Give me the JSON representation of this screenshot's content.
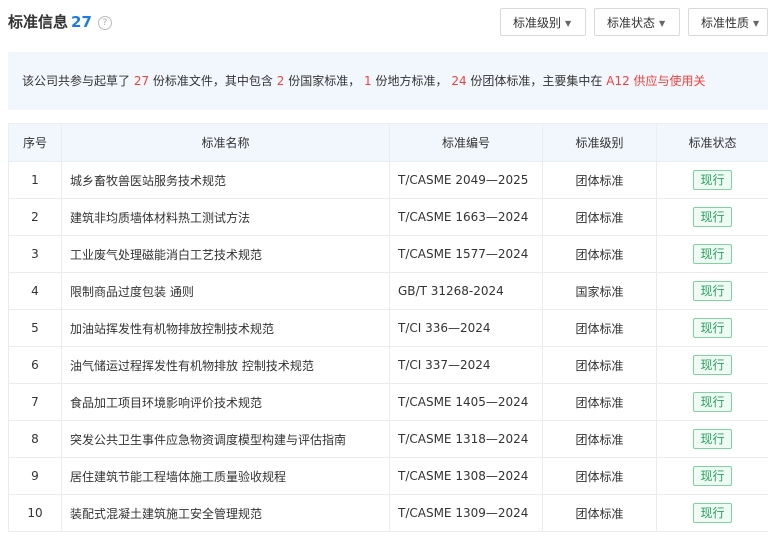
{
  "header": {
    "title": "标准信息",
    "count": "27",
    "help_icon": "?"
  },
  "filters": [
    {
      "label": "标准级别"
    },
    {
      "label": "标准状态"
    },
    {
      "label": "标准性质"
    }
  ],
  "summary": {
    "p1": "该公司共参与起草了 ",
    "n1": "27",
    "p2": " 份标准文件，其中包含 ",
    "n2": "2",
    "p3": " 份国家标准，  ",
    "n3": "1",
    "p4": " 份地方标准，  ",
    "n4": "24",
    "p5": " 份团体标准，主要集中在 ",
    "n5": "A12 供应与使用关",
    "accent_color": "#f5413d"
  },
  "table": {
    "columns": [
      "序号",
      "标准名称",
      "标准编号",
      "标准级别",
      "标准状态"
    ],
    "rows": [
      {
        "no": "1",
        "name": "城乡畜牧兽医站服务技术规范",
        "code": "T/CASME 2049—2025",
        "level": "团体标准",
        "status": "现行"
      },
      {
        "no": "2",
        "name": "建筑非均质墙体材料热工测试方法",
        "code": "T/CASME 1663—2024",
        "level": "团体标准",
        "status": "现行"
      },
      {
        "no": "3",
        "name": "工业废气处理磁能消白工艺技术规范",
        "code": "T/CASME 1577—2024",
        "level": "团体标准",
        "status": "现行"
      },
      {
        "no": "4",
        "name": "限制商品过度包装 通则",
        "code": "GB/T 31268-2024",
        "level": "国家标准",
        "status": "现行"
      },
      {
        "no": "5",
        "name": "加油站挥发性有机物排放控制技术规范",
        "code": "T/CI 336—2024",
        "level": "团体标准",
        "status": "现行"
      },
      {
        "no": "6",
        "name": "油气储运过程挥发性有机物排放 控制技术规范",
        "code": "T/CI 337—2024",
        "level": "团体标准",
        "status": "现行"
      },
      {
        "no": "7",
        "name": "食品加工项目环境影响评价技术规范",
        "code": "T/CASME 1405—2024",
        "level": "团体标准",
        "status": "现行"
      },
      {
        "no": "8",
        "name": "突发公共卫生事件应急物资调度模型构建与评估指南",
        "code": "T/CASME 1318—2024",
        "level": "团体标准",
        "status": "现行"
      },
      {
        "no": "9",
        "name": "居住建筑节能工程墙体施工质量验收规程",
        "code": "T/CASME 1308—2024",
        "level": "团体标准",
        "status": "现行"
      },
      {
        "no": "10",
        "name": "装配式混凝土建筑施工安全管理规范",
        "code": "T/CASME 1309—2024",
        "level": "团体标准",
        "status": "现行"
      }
    ]
  }
}
